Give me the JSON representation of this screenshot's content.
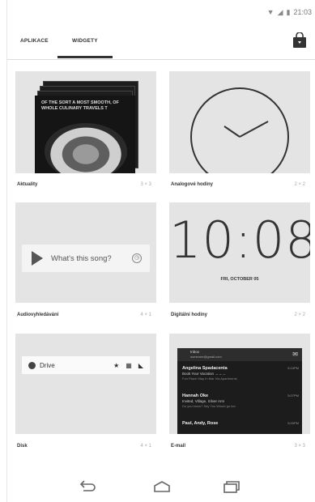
{
  "status": {
    "time": "21:03"
  },
  "tabs": {
    "apps": "APLIKACE",
    "widgets": "WIDGETY"
  },
  "widgets": [
    {
      "label": "Aktuality",
      "size": "3 × 3"
    },
    {
      "label": "Analogové hodiny",
      "size": "2 × 2"
    },
    {
      "label": "Audiovyhledávání",
      "size": "4 × 1"
    },
    {
      "label": "Digitální hodiny",
      "size": "2 × 2"
    },
    {
      "label": "Disk",
      "size": "4 × 1"
    },
    {
      "label": "E-mail",
      "size": "3 × 3"
    }
  ],
  "news": {
    "headline": "OF THE SORT A MOST SMOOTH, OF WHOLE CULINARY TRAVELS T"
  },
  "song": {
    "text": "What's this song?"
  },
  "digital": {
    "time": "10:08",
    "date": "FRI, OCTOBER 05"
  },
  "drive": {
    "name": "Drive"
  },
  "email": {
    "folder": "Inbox",
    "account": "someone@gmail.com",
    "items": [
      {
        "from": "Angelina Spadacenta",
        "subject": "Book Your Vacation →→→",
        "preview": "Fun Place Stay In Mar Via Apartments",
        "date": "5:15PM"
      },
      {
        "from": "Hannah Oke",
        "subject": "Invited, Village, Silver Arm",
        "preview": "Do you know? Say You Would go too",
        "date": "5:07PM"
      },
      {
        "from": "Paul, Andy, Rose",
        "subject": "",
        "preview": "",
        "date": "5:00PM"
      }
    ]
  },
  "icons": {
    "store": "shopping-bag-icon",
    "back": "back-icon",
    "home": "home-icon",
    "recents": "recents-icon"
  }
}
